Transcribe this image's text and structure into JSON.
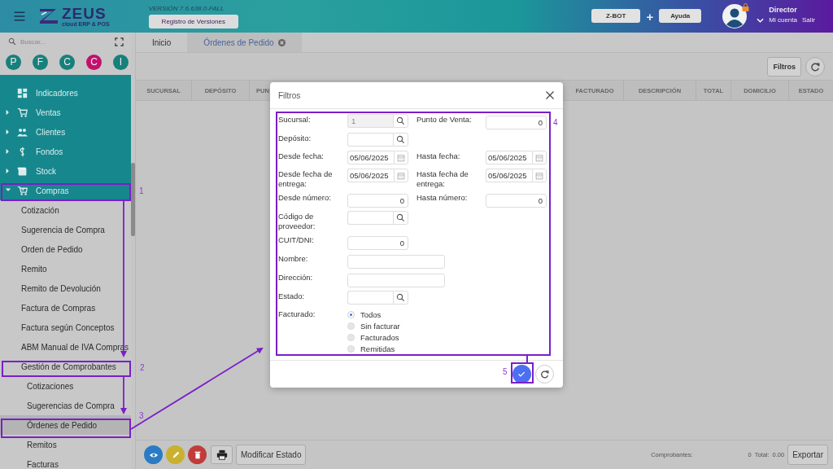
{
  "header": {
    "logo": {
      "name": "ZEUS",
      "tagline": "cloud ERP & POS"
    },
    "version": "VERSIÓN 7.6.638.0-FALL",
    "versions_button": "Registro de Versiones",
    "buttons": [
      "Z-BOT",
      "Ayuda"
    ],
    "plus": "+",
    "user": {
      "name": "Director",
      "links": [
        "Mi cuenta",
        "Salir"
      ]
    }
  },
  "sidebar": {
    "search_placeholder": "Buscar...",
    "shortcuts": [
      {
        "letter": "P",
        "color": "#17807c"
      },
      {
        "letter": "F",
        "color": "#17807c"
      },
      {
        "letter": "C",
        "color": "#17807c"
      },
      {
        "letter": "C",
        "color": "#c0126c"
      },
      {
        "letter": "I",
        "color": "#17807c"
      }
    ],
    "items": [
      {
        "label": "Indicadores",
        "selected": false
      },
      {
        "label": "Ventas",
        "expanded": false,
        "selected": false
      },
      {
        "label": "Clientes",
        "expanded": false,
        "selected": false
      },
      {
        "label": "Fondos",
        "expanded": false,
        "selected": false
      },
      {
        "label": "Stock",
        "expanded": false,
        "selected": false
      },
      {
        "label": "Compras",
        "expanded": true,
        "selected": false,
        "children": [
          {
            "label": "Cotización",
            "selected": false
          },
          {
            "label": "Sugerencia de Compra",
            "selected": false
          },
          {
            "label": "Orden de Pedido",
            "selected": false
          },
          {
            "label": "Remito",
            "selected": false
          },
          {
            "label": "Remito de Devolución",
            "selected": false
          },
          {
            "label": "Factura de Compras",
            "selected": false
          },
          {
            "label": "Factura según Conceptos",
            "selected": false
          },
          {
            "label": "ABM Manual de IVA Compras",
            "selected": false
          },
          {
            "label": "Gestión de Comprobantes",
            "expanded": true,
            "selected": false,
            "children": [
              {
                "label": "Cotizaciones",
                "selected": false
              },
              {
                "label": "Sugerencias de Compra",
                "selected": false
              },
              {
                "label": "Órdenes de Pedido",
                "selected": true
              },
              {
                "label": "Remitos",
                "selected": false
              },
              {
                "label": "Facturas",
                "selected": false
              }
            ]
          }
        ]
      }
    ]
  },
  "tabs": [
    {
      "label": "Inicio",
      "selected": false
    },
    {
      "label": "Órdenes de Pedido",
      "selected": true
    }
  ],
  "toolbar": {
    "filter_button": "Filtros"
  },
  "table": {
    "columns": [
      "SUCURSAL",
      "DEPÓSITO",
      "PUN",
      "FACTURADO",
      "DESCRIPCIÓN",
      "TOTAL",
      "DOMICILIO",
      "ESTADO"
    ]
  },
  "footer": {
    "modify_button": "Modificar Estado",
    "count_label": "Comprobantes:",
    "count": "0",
    "total_label": "Total:",
    "total": "0.00",
    "export_button": "Exportar"
  },
  "dialog": {
    "title": "Filtros",
    "rows": [
      {
        "cells": [
          {
            "label": "Sucursal:",
            "kind": "search",
            "value": "1",
            "disabled": true
          },
          {
            "label": "Punto de Venta:",
            "kind": "number",
            "value": "0",
            "disabled": false
          }
        ]
      },
      {
        "cells": [
          {
            "label": "Depósito:",
            "kind": "search",
            "disabled": false
          }
        ]
      },
      {
        "cells": [
          {
            "label": "Desde fecha:",
            "kind": "date",
            "value": "05/06/2025",
            "disabled": false
          },
          {
            "label": "Hasta fecha:",
            "kind": "date",
            "value": "05/06/2025",
            "disabled": false
          }
        ]
      },
      {
        "cells": [
          {
            "label": "Desde fecha de entrega:",
            "kind": "date",
            "value": "05/06/2025",
            "disabled": false
          },
          {
            "label": "Hasta fecha de entrega:",
            "kind": "date",
            "value": "05/06/2025",
            "disabled": false
          }
        ]
      },
      {
        "cells": [
          {
            "label": "Desde número:",
            "kind": "number",
            "value": "0",
            "disabled": false
          },
          {
            "label": "Hasta número:",
            "kind": "number",
            "value": "0",
            "disabled": false
          }
        ]
      },
      {
        "cells": [
          {
            "label": "Código de proveedor:",
            "kind": "search",
            "disabled": false
          }
        ]
      },
      {
        "cells": [
          {
            "label": "CUIT/DNI:",
            "kind": "number",
            "value": "0",
            "disabled": false
          }
        ]
      },
      {
        "cells": [
          {
            "label": "Nombre:",
            "kind": "text",
            "disabled": false
          }
        ]
      },
      {
        "cells": [
          {
            "label": "Dirección:",
            "kind": "text",
            "disabled": false
          }
        ]
      },
      {
        "cells": [
          {
            "label": "Estado:",
            "kind": "search",
            "disabled": false
          }
        ]
      },
      {
        "cells": [
          {
            "label": "Facturado:",
            "kind": "radio",
            "options": [
              {
                "label": "Todos",
                "selected": true
              },
              {
                "label": "Sin facturar",
                "selected": false
              },
              {
                "label": "Facturados",
                "selected": false
              },
              {
                "label": "Remitidas",
                "selected": false
              }
            ]
          }
        ]
      }
    ]
  },
  "annotations": [
    {
      "label": "1"
    },
    {
      "label": "2"
    },
    {
      "label": "3"
    },
    {
      "label": "4"
    },
    {
      "label": "5"
    }
  ]
}
